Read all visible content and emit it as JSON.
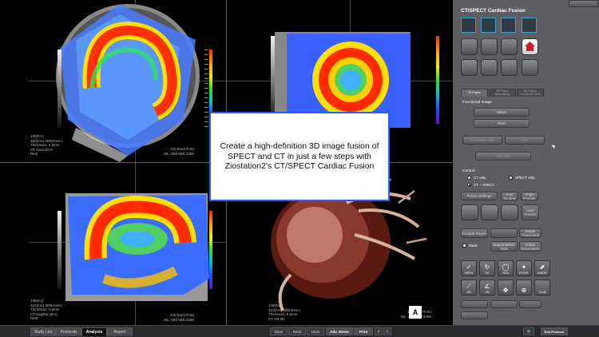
{
  "app": {
    "panel_title": "CT/SPECT Cardiac Fusion"
  },
  "popup": {
    "text": "Create a high-definition 3D image fusion of SPECT and CT in just a few steps with Ziostation2's CT/SPECT Cardiac Fusion"
  },
  "viewports": {
    "tl": {
      "info": "135(KV)\n310(mA) 400(msec)\nThickness: 0.5mm\nCT Axial 2D-A\nRest",
      "info_r": "220 93x170 53\nWL -598 WW 2286"
    },
    "tr": {
      "info": "",
      "info_r": ""
    },
    "bl": {
      "info": "135(KV)\n310(mA) 400(msec)\nThickness: 0.5mm\nCT Sagittal 2D-C\nRest",
      "info_r": "220 93x170 53\nWL -598 WW 2286"
    },
    "br": {
      "info": "135(KV)\n310(mA) 400(msec)\nThickness: 0.5mm\nCT VR 3D",
      "info_r": "220 93x170 53\nWL -598 WW 2286"
    },
    "corner_label": "A"
  },
  "panel": {
    "tabs": [
      "3D Fusion",
      "3D Fusion Accessibility",
      "3D Fusion Functional Table"
    ],
    "functional_image": "Functional Image",
    "stress": "Stress",
    "rest": "Rest",
    "correlate": "Correlate Mpr",
    "ace": "ACE",
    "edit_axis": "Edit Axis",
    "control": "Control",
    "ct_only": "CT only",
    "spect_only": "SPECT only",
    "ct_spect": "CT + SPECT",
    "fusion_settings": "Fusion Settings",
    "auto_window": "Auto Window",
    "angle_presets": "Angle Presets",
    "user_presets": "User Presets",
    "exclude_region": "Exclude Region",
    "single_frame_edit": "Single Frame Edit",
    "mask": "Mask",
    "segmentation_tools": "Segmentation Tools",
    "image_parameters": "Image Parameters",
    "tools": [
      "PATH",
      "3D",
      "ROI",
      "POINT",
      "MARK",
      "2D",
      "2D",
      "",
      "",
      "Tools"
    ]
  },
  "bottom": {
    "tabs": [
      "Study List",
      "Protocols",
      "Analysis",
      "Report"
    ],
    "buttons": [
      "Save",
      "Redo",
      "Undo",
      "Adv. Movie",
      "Print"
    ],
    "end_protocol": "End Protocol"
  }
}
